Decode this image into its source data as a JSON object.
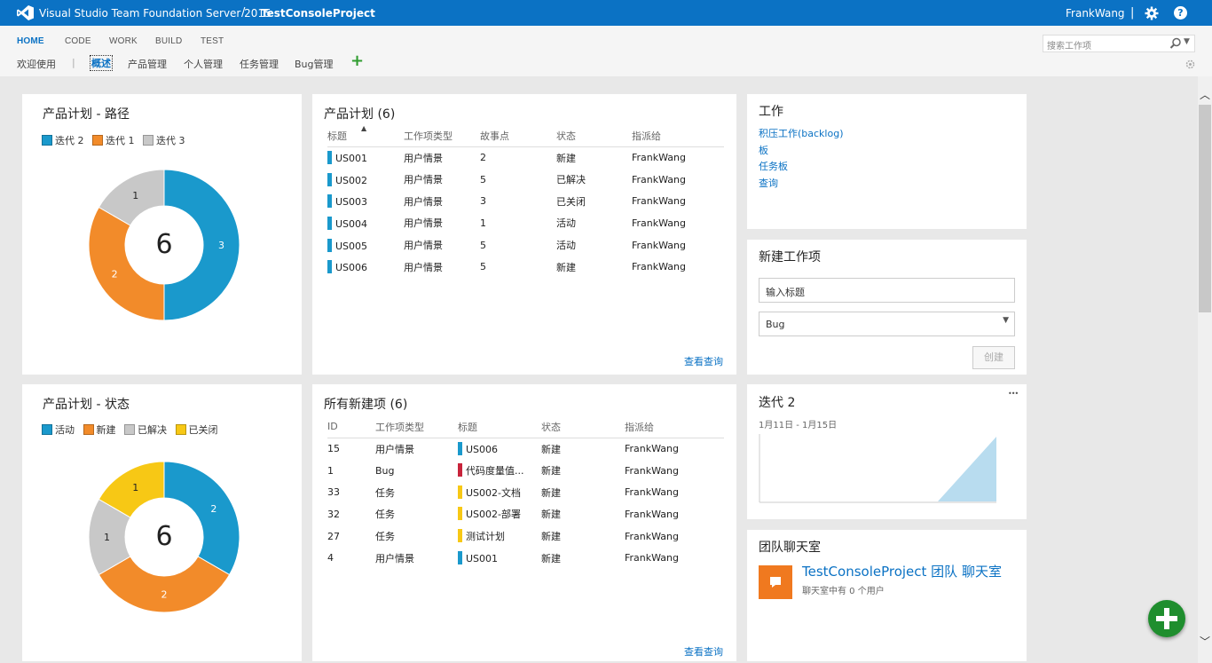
{
  "titlebar": {
    "product": "Visual Studio Team Foundation Server 2015",
    "separator": "/",
    "project": "TestConsoleProject",
    "user": "FrankWang",
    "divider": "|",
    "help": "?"
  },
  "nav": {
    "top": [
      "HOME",
      "CODE",
      "WORK",
      "BUILD",
      "TEST"
    ],
    "sub": {
      "welcome": "欢迎使用",
      "divider": "|",
      "items": [
        "概述",
        "产品管理",
        "个人管理",
        "任务管理",
        "Bug管理"
      ],
      "add": "+"
    },
    "search_placeholder": "搜索工作项"
  },
  "colors": {
    "accent": "#0b72c4",
    "blue": "#1a99cc",
    "orange": "#f28b2a",
    "gray": "#c8c8c8",
    "yellow": "#f7c815",
    "red": "#c8243b",
    "green": "#1f8e2e"
  },
  "tile_path": {
    "title": "产品计划 - 路径",
    "legend": [
      "迭代 2",
      "迭代 1",
      "迭代 3"
    ],
    "total": "6",
    "chart_data": {
      "type": "pie",
      "labels": [
        "迭代 2",
        "迭代 1",
        "迭代 3"
      ],
      "values": [
        3,
        2,
        1
      ],
      "total": 6
    }
  },
  "tile_status": {
    "title": "产品计划 - 状态",
    "legend": [
      "活动",
      "新建",
      "已解决",
      "已关闭"
    ],
    "total": "6",
    "chart_data": {
      "type": "pie",
      "slices": [
        {
          "label": "活动",
          "value": 2
        },
        {
          "label": "新建",
          "value": 2
        },
        {
          "label": "已解决",
          "value": 1
        },
        {
          "label": "已关闭",
          "value": 1
        }
      ],
      "total": 6
    }
  },
  "tile_backlog": {
    "title": "产品计划 (6)",
    "sort_indicator": "▲",
    "columns": [
      "标题",
      "工作项类型",
      "故事点",
      "状态",
      "指派给"
    ],
    "rows": [
      [
        "US001",
        "用户情景",
        "2",
        "新建",
        "FrankWang"
      ],
      [
        "US002",
        "用户情景",
        "5",
        "已解决",
        "FrankWang"
      ],
      [
        "US003",
        "用户情景",
        "3",
        "已关闭",
        "FrankWang"
      ],
      [
        "US004",
        "用户情景",
        "1",
        "活动",
        "FrankWang"
      ],
      [
        "US005",
        "用户情景",
        "5",
        "活动",
        "FrankWang"
      ],
      [
        "US006",
        "用户情景",
        "5",
        "新建",
        "FrankWang"
      ]
    ],
    "link": "查看查询"
  },
  "tile_new": {
    "title": "所有新建项 (6)",
    "columns": [
      "ID",
      "工作项类型",
      "标题",
      "状态",
      "指派给"
    ],
    "rows": [
      [
        "15",
        "用户情景",
        "US006",
        "新建",
        "FrankWang"
      ],
      [
        "1",
        "Bug",
        "代码度量值...",
        "新建",
        "FrankWang"
      ],
      [
        "33",
        "任务",
        "US002-文档",
        "新建",
        "FrankWang"
      ],
      [
        "32",
        "任务",
        "US002-部署",
        "新建",
        "FrankWang"
      ],
      [
        "27",
        "任务",
        "测试计划",
        "新建",
        "FrankWang"
      ],
      [
        "4",
        "用户情景",
        "US001",
        "新建",
        "FrankWang"
      ]
    ],
    "link": "查看查询"
  },
  "tile_work": {
    "title": "工作",
    "links": [
      "积压工作(backlog)",
      "板",
      "任务板",
      "查询"
    ]
  },
  "tile_newitem": {
    "title": "新建工作项",
    "title_placeholder": "输入标题",
    "type_value": "Bug",
    "caret": "▼",
    "create": "创建"
  },
  "tile_iteration": {
    "title": "迭代 2",
    "dates": "1月11日 - 1月15日",
    "more": "•••"
  },
  "tile_chat": {
    "title": "团队聊天室",
    "room": "TestConsoleProject 团队 聊天室",
    "sub": "聊天室中有 0 个用户"
  },
  "scroll": {
    "up": "︿",
    "down": "﹀"
  }
}
